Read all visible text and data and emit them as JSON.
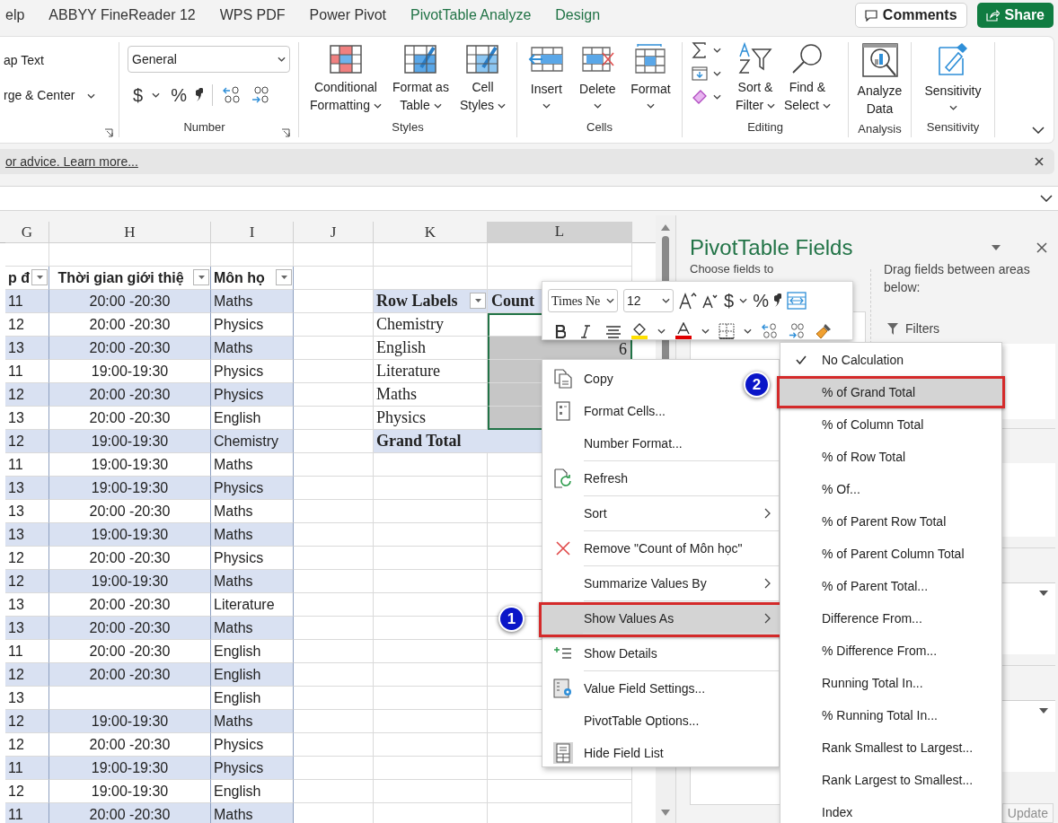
{
  "ribbon_tabs": [
    {
      "label": "elp",
      "kind": "standard"
    },
    {
      "label": "ABBYY FineReader 12",
      "kind": "standard"
    },
    {
      "label": "WPS PDF",
      "kind": "standard"
    },
    {
      "label": "Power Pivot",
      "kind": "standard"
    },
    {
      "label": "PivotTable Analyze",
      "kind": "contextual"
    },
    {
      "label": "Design",
      "kind": "contextual"
    }
  ],
  "header_buttons": {
    "comments": "Comments",
    "share": "Share"
  },
  "ribbon": {
    "alignment": {
      "wrap_text": "ap Text",
      "merge_center": "rge & Center"
    },
    "number": {
      "format": "General",
      "currency": "$",
      "percent": "%",
      "label": "Number"
    },
    "styles": {
      "buttons": [
        {
          "lines": [
            "Conditional",
            "Formatting"
          ]
        },
        {
          "lines": [
            "Format as",
            "Table"
          ]
        },
        {
          "lines": [
            "Cell",
            "Styles"
          ]
        }
      ],
      "label": "Styles"
    },
    "cells": {
      "buttons": [
        "Insert",
        "Delete",
        "Format"
      ],
      "label": "Cells"
    },
    "editing": {
      "buttons": [
        {
          "lines": [
            "Sort &",
            "Filter"
          ]
        },
        {
          "lines": [
            "Find &",
            "Select"
          ]
        }
      ],
      "label": "Editing"
    },
    "analysis": {
      "button": {
        "lines": [
          "Analyze",
          "Data"
        ]
      },
      "label": "Analysis"
    },
    "sensitivity": {
      "button": "Sensitivity",
      "label": "Sensitivity"
    }
  },
  "message_bar": {
    "link": "or advice. Learn more..."
  },
  "sheet": {
    "columns": [
      {
        "label": "G",
        "selected": false
      },
      {
        "label": "H",
        "selected": false
      },
      {
        "label": "I",
        "selected": false
      },
      {
        "label": "J",
        "selected": false
      },
      {
        "label": "K",
        "selected": false
      },
      {
        "label": "L",
        "selected": true
      }
    ],
    "table": {
      "headers": [
        "p đ",
        "Thời gian giới thiệ",
        "Môn họ"
      ],
      "rows": [
        {
          "col_g": "11",
          "col_h": "20:00 -20:30",
          "col_i": "Maths"
        },
        {
          "col_g": "12",
          "col_h": "20:00 -20:30",
          "col_i": "Physics"
        },
        {
          "col_g": "13",
          "col_h": "20:00 -20:30",
          "col_i": "Maths"
        },
        {
          "col_g": "11",
          "col_h": "19:00-19:30",
          "col_i": "Physics"
        },
        {
          "col_g": "12",
          "col_h": "20:00 -20:30",
          "col_i": "Physics"
        },
        {
          "col_g": "13",
          "col_h": "20:00 -20:30",
          "col_i": "English"
        },
        {
          "col_g": "12",
          "col_h": "19:00-19:30",
          "col_i": "Chemistry"
        },
        {
          "col_g": "11",
          "col_h": "19:00-19:30",
          "col_i": "Maths"
        },
        {
          "col_g": "13",
          "col_h": "19:00-19:30",
          "col_i": "Physics"
        },
        {
          "col_g": "13",
          "col_h": "20:00 -20:30",
          "col_i": "Maths"
        },
        {
          "col_g": "13",
          "col_h": "19:00-19:30",
          "col_i": "Maths"
        },
        {
          "col_g": "12",
          "col_h": "20:00 -20:30",
          "col_i": "Physics"
        },
        {
          "col_g": "12",
          "col_h": "19:00-19:30",
          "col_i": "Maths"
        },
        {
          "col_g": "13",
          "col_h": "20:00 -20:30",
          "col_i": "Literature"
        },
        {
          "col_g": "13",
          "col_h": "20:00 -20:30",
          "col_i": "Maths"
        },
        {
          "col_g": "11",
          "col_h": "20:00 -20:30",
          "col_i": "English"
        },
        {
          "col_g": "12",
          "col_h": "20:00 -20:30",
          "col_i": "English"
        },
        {
          "col_g": "13",
          "col_i": "English"
        },
        {
          "col_g": "12",
          "col_h": "19:00-19:30",
          "col_i": "Maths"
        },
        {
          "col_g": "12",
          "col_h": "20:00 -20:30",
          "col_i": "Physics"
        },
        {
          "col_g": "11",
          "col_h": "19:00-19:30",
          "col_i": "Physics"
        },
        {
          "col_g": "12",
          "col_h": "19:00-19:30",
          "col_i": "English"
        },
        {
          "col_g": "11",
          "col_h": "20:00 -20:30",
          "col_i": "Maths"
        }
      ]
    },
    "pivot": {
      "headers": [
        "Row Labels",
        "Count"
      ],
      "rows": [
        {
          "label": "Chemistry",
          "active": true
        },
        {
          "label": "English",
          "value": "6",
          "active": false
        },
        {
          "label": "Literature",
          "active": false
        },
        {
          "label": "Maths",
          "active": false
        },
        {
          "label": "Physics",
          "active": false
        }
      ],
      "grand_total": "Grand Total"
    }
  },
  "mini_toolbar": {
    "font": "Times Ne",
    "size": "12",
    "currency": "$",
    "percent": "%"
  },
  "context_menu": [
    {
      "label": "Copy",
      "submenu": false,
      "selected": false,
      "separator_after": false
    },
    {
      "label": "Format Cells...",
      "submenu": false,
      "selected": false,
      "separator_after": false
    },
    {
      "label": "Number Format...",
      "submenu": false,
      "selected": false,
      "separator_after": true
    },
    {
      "label": "Refresh",
      "submenu": false,
      "selected": false,
      "separator_after": true
    },
    {
      "label": "Sort",
      "submenu": true,
      "selected": false,
      "separator_after": true
    },
    {
      "label": "Remove \"Count of Môn học\"",
      "submenu": false,
      "selected": false,
      "separator_after": true
    },
    {
      "label": "Summarize Values By",
      "submenu": true,
      "selected": false,
      "separator_after": true
    },
    {
      "label": "Show Values As",
      "submenu": true,
      "selected": true,
      "separator_after": true
    },
    {
      "label": "Show Details",
      "submenu": false,
      "selected": false,
      "separator_after": true
    },
    {
      "label": "Value Field Settings...",
      "submenu": false,
      "selected": false,
      "separator_after": false
    },
    {
      "label": "PivotTable Options...",
      "submenu": false,
      "selected": false,
      "separator_after": false
    },
    {
      "label": "Hide Field List",
      "submenu": false,
      "selected": false,
      "separator_after": false
    }
  ],
  "submenu": [
    {
      "label": "No Calculation",
      "checked": true,
      "selected": false
    },
    {
      "label": "% of Grand Total",
      "checked": false,
      "selected": true
    },
    {
      "label": "% of Column Total",
      "checked": false,
      "selected": false
    },
    {
      "label": "% of Row Total",
      "checked": false,
      "selected": false
    },
    {
      "label": "% Of...",
      "checked": false,
      "selected": false
    },
    {
      "label": "% of Parent Row Total",
      "checked": false,
      "selected": false
    },
    {
      "label": "% of Parent Column Total",
      "checked": false,
      "selected": false
    },
    {
      "label": "% of Parent Total...",
      "checked": false,
      "selected": false
    },
    {
      "label": "Difference From...",
      "checked": false,
      "selected": false
    },
    {
      "label": "% Difference From...",
      "checked": false,
      "selected": false
    },
    {
      "label": "Running Total In...",
      "checked": false,
      "selected": false
    },
    {
      "label": "% Running Total In...",
      "checked": false,
      "selected": false
    },
    {
      "label": "Rank Smallest to Largest...",
      "checked": false,
      "selected": false
    },
    {
      "label": "Rank Largest to Smallest...",
      "checked": false,
      "selected": false
    },
    {
      "label": "Index",
      "checked": false,
      "selected": false
    }
  ],
  "callouts": [
    "1",
    "2"
  ],
  "pivot_fields": {
    "title": "PivotTable Fields",
    "choose_label": "Choose fields to",
    "drag_label": "Drag fields between areas below:",
    "filters": "Filters",
    "update_button": {
      "label": "Update",
      "disabled": true
    }
  }
}
